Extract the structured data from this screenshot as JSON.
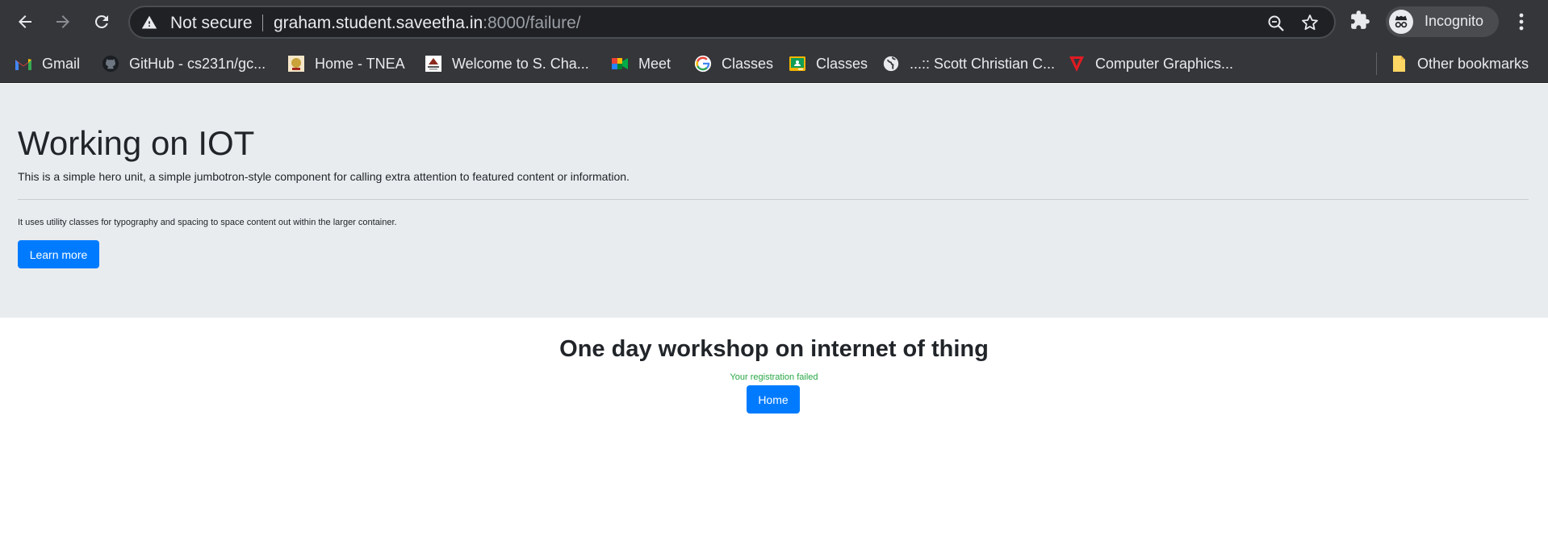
{
  "browser": {
    "security_label": "Not secure",
    "url_host": "graham.student.saveetha.in",
    "url_rest": ":8000/failure/",
    "profile_label": "Incognito"
  },
  "bookmarks": [
    {
      "label": "Gmail",
      "icon": "gmail-icon"
    },
    {
      "label": "GitHub - cs231n/gc...",
      "icon": "github-icon"
    },
    {
      "label": "Home - TNEA",
      "icon": "tnea-icon"
    },
    {
      "label": "Welcome to S. Cha...",
      "icon": "college-icon"
    },
    {
      "label": "Meet",
      "icon": "meet-icon"
    },
    {
      "label": "Classes",
      "icon": "google-icon"
    },
    {
      "label": "Classes",
      "icon": "classroom-icon"
    },
    {
      "label": "...:: Scott Christian C...",
      "icon": "globe-icon"
    },
    {
      "label": "Computer Graphics...",
      "icon": "graphics-icon"
    }
  ],
  "other_bookmarks": "Other bookmarks",
  "hero": {
    "title": "Working on IOT",
    "lead": "This is a simple hero unit, a simple jumbotron-style component for calling extra attention to featured content or information.",
    "text": "It uses utility classes for typography and spacing to space content out within the larger container.",
    "button": "Learn more"
  },
  "main": {
    "title": "One day workshop on internet of thing",
    "status": "Your registration failed",
    "home_button": "Home"
  },
  "colors": {
    "primary": "#007bff",
    "success": "#28a745",
    "hero_bg": "#e9ecef",
    "chrome_bg": "#35363a"
  }
}
